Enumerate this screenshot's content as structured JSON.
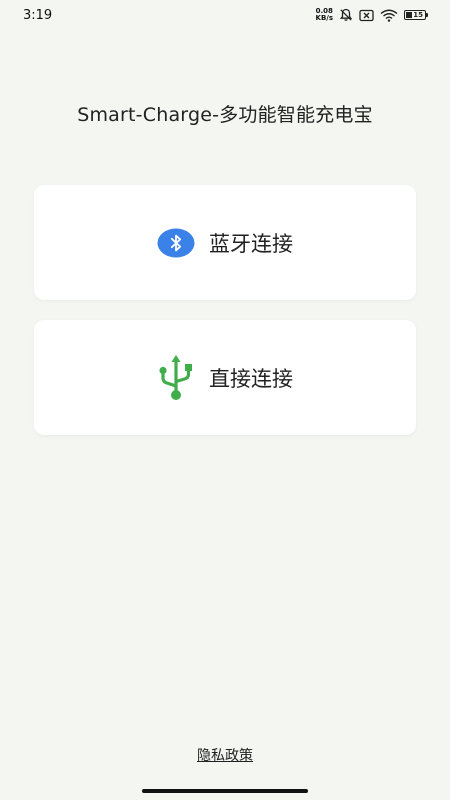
{
  "status_bar": {
    "time": "3:19",
    "net_speed_value": "0.08",
    "net_speed_unit": "KB/s",
    "battery_level": "15"
  },
  "app": {
    "title": "Smart-Charge-多功能智能充电宝"
  },
  "connections": {
    "bluetooth": {
      "label": "蓝牙连接",
      "icon": "bluetooth-icon",
      "color": "#3b82e8"
    },
    "direct": {
      "label": "直接连接",
      "icon": "usb-icon",
      "color": "#3fae4a"
    }
  },
  "footer": {
    "privacy_label": "隐私政策"
  }
}
